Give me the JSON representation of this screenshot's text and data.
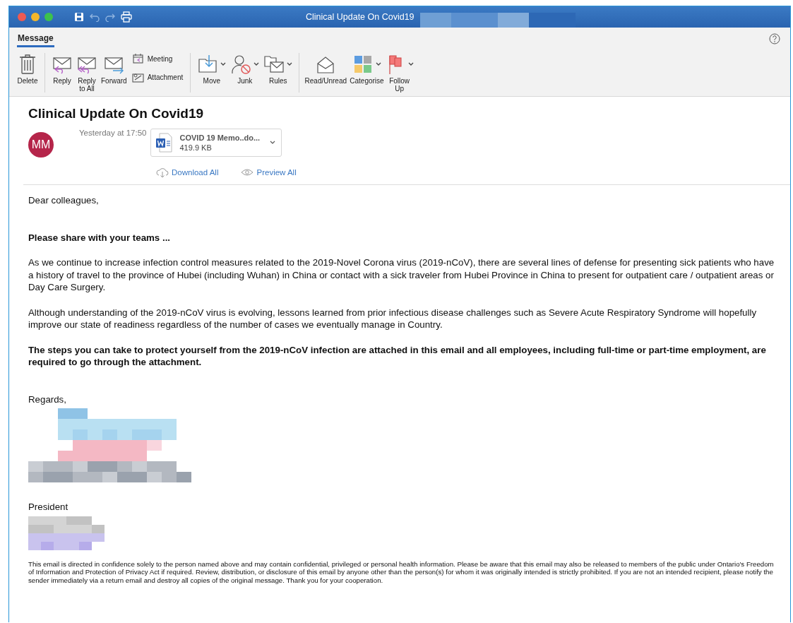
{
  "window": {
    "title": "Clinical Update On Covid19"
  },
  "ribbon": {
    "tabs": [
      {
        "label": "Message",
        "selected": true
      }
    ],
    "groups": [
      {
        "buttons": [
          {
            "label": "Delete",
            "kind": "large",
            "has_menu": false
          }
        ]
      },
      {
        "buttons": [
          {
            "label": "Reply",
            "kind": "large",
            "has_menu": false
          },
          {
            "label": "Reply to All",
            "kind": "large",
            "has_menu": false
          },
          {
            "label": "Forward",
            "kind": "large",
            "has_menu": false
          },
          {
            "label": "Meeting",
            "kind": "small",
            "has_menu": false
          },
          {
            "label": "Attachment",
            "kind": "small",
            "has_menu": false
          }
        ]
      },
      {
        "buttons": [
          {
            "label": "Move",
            "kind": "large",
            "has_menu": true
          },
          {
            "label": "Junk",
            "kind": "large",
            "has_menu": true
          },
          {
            "label": "Rules",
            "kind": "large",
            "has_menu": true
          }
        ]
      },
      {
        "buttons": [
          {
            "label": "Read/Unread",
            "kind": "large",
            "has_menu": false
          },
          {
            "label": "Categorise",
            "kind": "large",
            "has_menu": true
          },
          {
            "label": "Follow Up",
            "kind": "large",
            "has_menu": true
          }
        ]
      }
    ]
  },
  "message": {
    "subject": "Clinical Update On Covid19",
    "avatar": {
      "initials": "MM",
      "color": "#b5254a"
    },
    "time": "Yesterday at 17:50",
    "attachment": {
      "name": "COVID 19 Memo..do...",
      "size": "419.9 KB"
    },
    "actions": [
      "Download All",
      "Preview All"
    ],
    "body": [
      {
        "kind": "text",
        "text": "Dear colleagues,",
        "bold": false
      },
      {
        "kind": "text",
        "text": "Please share with your teams ...",
        "bold": true
      },
      {
        "kind": "text",
        "text": "As we continue to increase infection control measures related to the 2019-Novel Corona virus (2019-nCoV), there are several lines of defense for presenting sick patients who have a history of travel to the province of Hubei (including Wuhan) in China or contact with a sick traveler from Hubei Province in China to present for outpatient care / outpatient areas or Day Care Surgery.",
        "bold": false
      },
      {
        "kind": "text",
        "text": "Although understanding of the 2019-nCoV virus is evolving, lessons learned from prior infectious disease challenges such as Severe Acute Respiratory Syndrome will hopefully improve our state of readiness regardless of the number of cases we eventually manage in Country.",
        "bold": false
      },
      {
        "kind": "text",
        "text": "The steps you can take to protect yourself from the 2019-nCoV infection are attached in this email and all employees, including full-time or part-time employment, are required to go through the attachment.",
        "bold": true
      },
      {
        "kind": "text",
        "text": "Regards,",
        "bold": false
      },
      {
        "kind": "redacted"
      },
      {
        "kind": "text",
        "text": "President",
        "bold": false
      },
      {
        "kind": "redacted"
      },
      {
        "kind": "disclaimer",
        "text": "This email is directed in confidence solely to the person named above and may contain confidential, privileged or personal health information. Please be aware that this email may also be released to members of the public under Ontario's Freedom of Information and Protection of Privacy Act if required. Review, distribution, or disclosure of this email by anyone other than the person(s) for whom it was originally intended is strictly prohibited. If you are not an intended recipient, please notify the sender immediately via a return email and destroy all copies of the original message. Thank you for your cooperation.",
        "bold": false
      }
    ]
  }
}
